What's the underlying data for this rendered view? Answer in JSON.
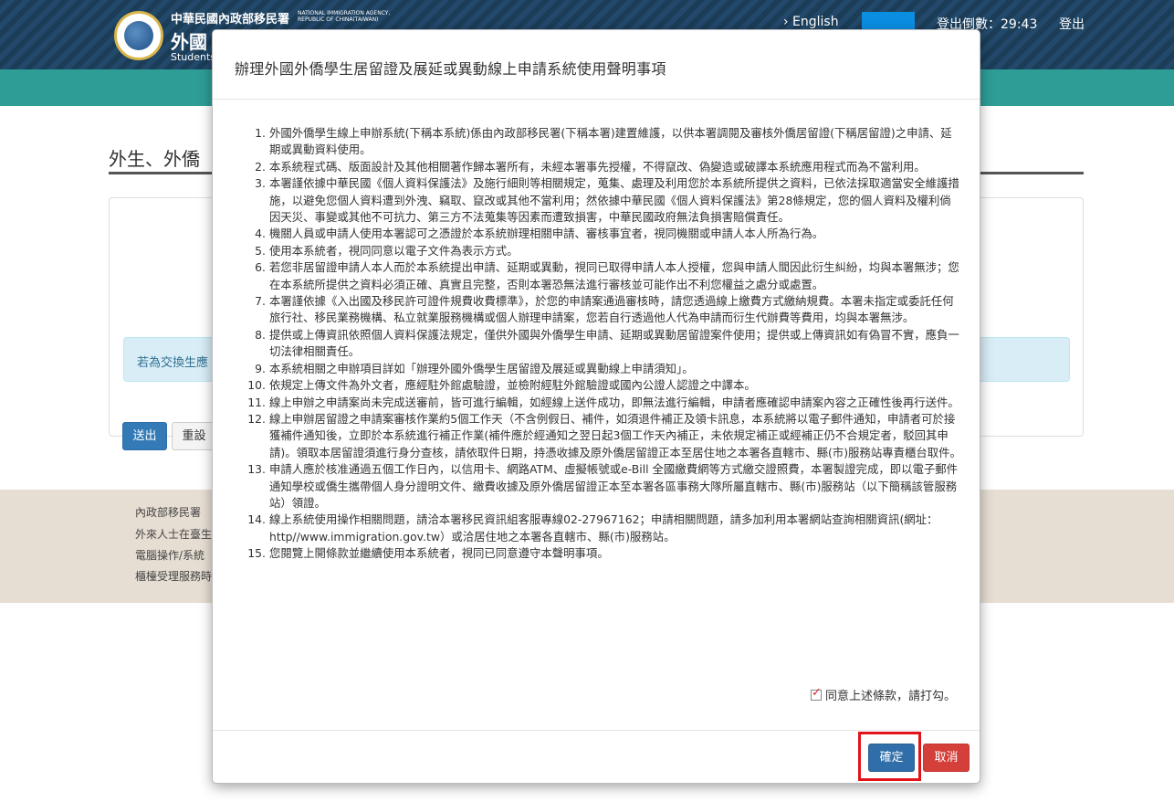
{
  "header": {
    "agency_zh": "中華民國內政部移民署",
    "agency_en": "NATIONAL IMMIGRATION AGENCY, REPUBLIC OF CHINA(TAIWAN)",
    "site_title": "外國",
    "site_sub": "Students",
    "english_link": "› English",
    "countdown": "登出倒數：29:43",
    "logout": "登出"
  },
  "background": {
    "page_title": "外生、外僑",
    "info_text": "若為交換生應",
    "submit_label": "送出",
    "reset_label": "重設",
    "footer_lines": [
      "內政部移民署",
      "外來人士在臺生",
      "電腦操作/系統",
      "櫃檯受理服務時"
    ]
  },
  "modal": {
    "title": "辦理外國外僑學生居留證及展延或異動線上申請系統使用聲明事項",
    "terms": [
      {
        "num": "1.",
        "text": "外國外僑學生線上申辦系統(下稱本系統)係由內政部移民署(下稱本署)建置維護，以供本署調閱及審核外僑居留證(下稱居留證)之申請、延期或異動資料使用。"
      },
      {
        "num": "2.",
        "text": "本系統程式碼、版面設計及其他相關著作歸本署所有，未經本署事先授權，不得竄改、偽變造或破譯本系統應用程式而為不當利用。"
      },
      {
        "num": "3.",
        "text": "本署謹依據中華民國《個人資料保護法》及施行細則等相關規定，蒐集、處理及利用您於本系統所提供之資料，已依法採取適當安全維護措施，以避免您個人資料遭到外洩、竊取、竄改或其他不當利用；然依據中華民國《個人資料保護法》第28條規定，您的個人資料及權利倘因天災、事變或其他不可抗力、第三方不法蒐集等因素而遭致損害，中華民國政府無法負損害賠償責任。"
      },
      {
        "num": "4.",
        "text": "機關人員或申請人使用本署認可之憑證於本系統辦理相關申請、審核事宜者，視同機關或申請人本人所為行為。"
      },
      {
        "num": "5.",
        "text": "使用本系統者，視同同意以電子文件為表示方式。"
      },
      {
        "num": "6.",
        "text": "若您非居留證申請人本人而於本系統提出申請、延期或異動，視同已取得申請人本人授權，您與申請人間因此衍生糾紛，均與本署無涉；您在本系統所提供之資料必須正確、真實且完整，否則本署恐無法進行審核並可能作出不利您權益之處分或處置。"
      },
      {
        "num": "7.",
        "text": "本署謹依據《入出國及移民許可證件規費收費標準》，於您的申請案通過審核時，請您透過線上繳費方式繳納規費。本署未指定或委託任何旅行社、移民業務機構、私立就業服務機構或個人辦理申請案，您若自行透過他人代為申請而衍生代辦費等費用，均與本署無涉。"
      },
      {
        "num": "8.",
        "text": "提供或上傳資訊依照個人資料保護法規定，僅供外國與外僑學生申請、延期或異動居留證案件使用；提供或上傳資訊如有偽冒不實，應負一切法律相關責任。"
      },
      {
        "num": "9.",
        "text": "本系統相關之申辦項目詳如「辦理外國外僑學生居留證及展延或異動線上申請須知」。"
      },
      {
        "num": "10.",
        "text": "依規定上傳文件為外文者，應經駐外館處驗證，並檢附經駐外館驗證或國內公證人認證之中譯本。"
      },
      {
        "num": "11.",
        "text": "線上申辦之申請案尚未完成送審前，皆可進行編輯，如經線上送件成功，即無法進行編輯，申請者應確認申請案內容之正確性後再行送件。"
      },
      {
        "num": "12.",
        "text": "線上申辦居留證之申請案審核作業約5個工作天（不含例假日、補件，如須退件補正及領卡訊息，本系統將以電子郵件通知，申請者可於接獲補件通知後，立即於本系統進行補正作業(補件應於經通知之翌日起3個工作天內補正，未依規定補正或經補正仍不合規定者，駁回其申請)。領取本居留證須進行身分查核，請依取件日期，持憑收據及原外僑居留證正本至居住地之本署各直轄市、縣(市)服務站專責櫃台取件。"
      },
      {
        "num": "13.",
        "text": "申請人應於核准通過五個工作日內，以信用卡、網路ATM、虛擬帳號或e-Bill 全國繳費網等方式繳交證照費，本署製證完成，即以電子郵件通知學校或僑生攜帶個人身分證明文件、繳費收據及原外僑居留證正本至本署各區事務大隊所屬直轄市、縣(市)服務站（以下簡稱該管服務站）領證。"
      },
      {
        "num": "14.",
        "text": "線上系統使用操作相關問題，請洽本署移民資訊組客服專線02-27967162；申請相關問題，請多加利用本署網站查詢相關資訊(網址：http//www.immigration.gov.tw）或洽居住地之本署各直轄市、縣(市)服務站。"
      },
      {
        "num": "15.",
        "text": "您閱覽上開條款並繼續使用本系統者，視同已同意遵守本聲明事項。"
      }
    ],
    "agree_label": "同意上述條款，請打勾。",
    "agree_checked": true,
    "ok_label": "確定",
    "cancel_label": "取消"
  },
  "colors": {
    "header_bg": "#1b3d57",
    "teal_bar": "#2e9d95",
    "primary_button": "#2f6ea8",
    "cancel_button": "#d43f3a",
    "highlight_border": "#e1141b"
  }
}
